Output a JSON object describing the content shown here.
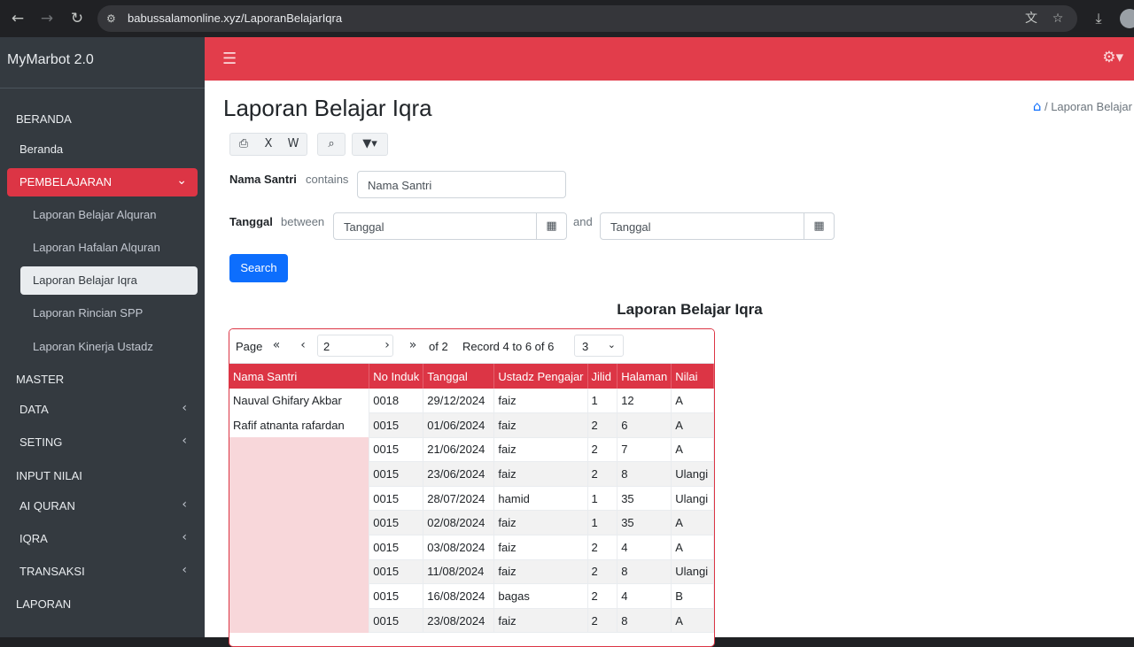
{
  "browser": {
    "url": "babussalamonline.xyz/LaporanBelajarIqra",
    "icons": {
      "back": "arrow-left-icon",
      "forward": "arrow-right-icon",
      "reload": "reload-icon",
      "site": "site-settings-icon",
      "translate": "translate-icon",
      "bookmark": "star-icon",
      "download": "download-icon"
    }
  },
  "sidebar": {
    "brand": "MyMarbot 2.0",
    "sections": {
      "beranda_header": "BERANDA",
      "beranda": "Beranda",
      "pembelajaran": "PEMBELAJARAN",
      "sub_items": [
        "Laporan Belajar Alquran",
        "Laporan Hafalan Alquran",
        "Laporan Belajar Iqra",
        "Laporan Rincian SPP",
        "Laporan Kinerja Ustadz"
      ],
      "master_header": "MASTER",
      "data": "DATA",
      "seting": "SETING",
      "input_header": "INPUT NILAI",
      "alquran": "AI QURAN",
      "iqra": "IQRA",
      "transaksi": "TRANSAKSI",
      "laporan_header": "LAPORAN"
    },
    "active_item": "Laporan Belajar Iqra"
  },
  "header": {
    "menu_icon": "hamburger-icon",
    "settings_icon": "gear-icon"
  },
  "page": {
    "title": "Laporan Belajar Iqra",
    "breadcrumb": "Laporan Belajar"
  },
  "toolbar": {
    "icons": [
      "print-icon",
      "excel-icon",
      "word-icon",
      "search-icon",
      "filter-icon"
    ]
  },
  "filters": {
    "nama_label": "Nama Santri",
    "nama_op": "contains",
    "nama_placeholder": "Nama Santri",
    "tanggal_label": "Tanggal",
    "tanggal_op": "between",
    "tanggal_from_placeholder": "Tanggal",
    "and_label": "and",
    "tanggal_to_placeholder": "Tanggal",
    "search_label": "Search"
  },
  "report": {
    "title": "Laporan Belajar Iqra",
    "pager": {
      "page_label": "Page",
      "page_value": "2",
      "of_label": "of 2",
      "record_label": "Record 4 to 6 of 6",
      "page_size": "3"
    },
    "columns": [
      "Nama Santri",
      "No Induk",
      "Tanggal",
      "Ustadz Pengajar",
      "Jilid",
      "Halaman",
      "Nilai"
    ],
    "rows": [
      [
        "Nauval Ghifary Akbar",
        "0018",
        "29/12/2024",
        "faiz",
        "1",
        "12",
        "A"
      ],
      [
        "Rafif atnanta rafardan",
        "0015",
        "01/06/2024",
        "faiz",
        "2",
        "6",
        "A"
      ],
      [
        "",
        "0015",
        "21/06/2024",
        "faiz",
        "2",
        "7",
        "A"
      ],
      [
        "",
        "0015",
        "23/06/2024",
        "faiz",
        "2",
        "8",
        "Ulangi"
      ],
      [
        "",
        "0015",
        "28/07/2024",
        "hamid",
        "1",
        "35",
        "Ulangi"
      ],
      [
        "",
        "0015",
        "02/08/2024",
        "faiz",
        "1",
        "35",
        "A"
      ],
      [
        "",
        "0015",
        "03/08/2024",
        "faiz",
        "2",
        "4",
        "A"
      ],
      [
        "",
        "0015",
        "11/08/2024",
        "faiz",
        "2",
        "8",
        "Ulangi"
      ],
      [
        "",
        "0015",
        "16/08/2024",
        "bagas",
        "2",
        "4",
        "B"
      ],
      [
        "",
        "0015",
        "23/08/2024",
        "faiz",
        "2",
        "8",
        "A"
      ]
    ]
  }
}
